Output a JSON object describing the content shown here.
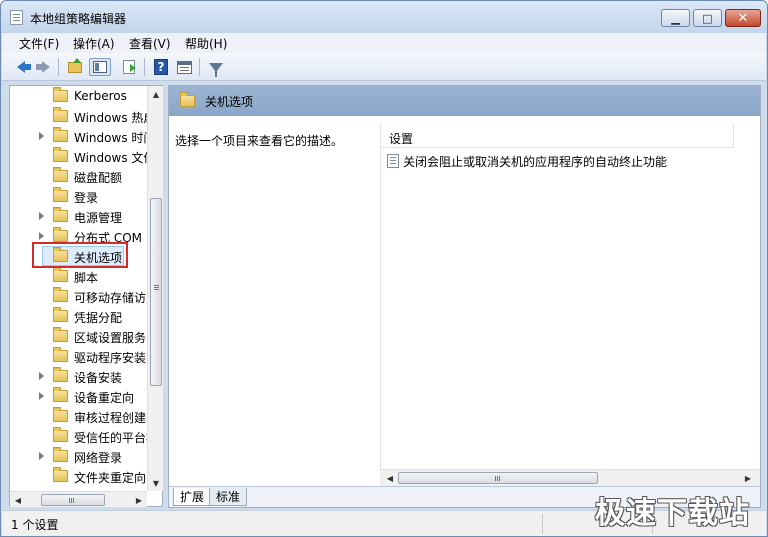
{
  "window": {
    "title": "本地组策略编辑器"
  },
  "menu": [
    {
      "label": "文件(F)"
    },
    {
      "label": "操作(A)"
    },
    {
      "label": "查看(V)"
    },
    {
      "label": "帮助(H)"
    }
  ],
  "tree": {
    "items": [
      {
        "label": "Kerberos",
        "expandable": false
      },
      {
        "label": "Windows 热启动",
        "expandable": false
      },
      {
        "label": "Windows 时间服务",
        "expandable": true
      },
      {
        "label": "Windows 文件保护",
        "expandable": false
      },
      {
        "label": "磁盘配额",
        "expandable": false
      },
      {
        "label": "登录",
        "expandable": false
      },
      {
        "label": "电源管理",
        "expandable": true
      },
      {
        "label": "分布式 COM",
        "expandable": true
      },
      {
        "label": "关机选项",
        "expandable": false,
        "selected": true
      },
      {
        "label": "脚本",
        "expandable": false
      },
      {
        "label": "可移动存储访问",
        "expandable": false
      },
      {
        "label": "凭据分配",
        "expandable": false
      },
      {
        "label": "区域设置服务",
        "expandable": false
      },
      {
        "label": "驱动程序安装",
        "expandable": false
      },
      {
        "label": "设备安装",
        "expandable": true
      },
      {
        "label": "设备重定向",
        "expandable": true
      },
      {
        "label": "审核过程创建",
        "expandable": false
      },
      {
        "label": "受信任的平台模块服务",
        "expandable": false
      },
      {
        "label": "网络登录",
        "expandable": true
      },
      {
        "label": "文件夹重定向",
        "expandable": false
      }
    ]
  },
  "details": {
    "header_title": "关机选项",
    "description": "选择一个项目来查看它的描述。",
    "column_header": "设置",
    "settings": [
      {
        "label": "关闭会阻止或取消关机的应用程序的自动终止功能"
      }
    ]
  },
  "tabs": [
    {
      "label": "扩展",
      "active": true
    },
    {
      "label": "标准",
      "active": false
    }
  ],
  "status": {
    "text": "1 个设置"
  },
  "watermark": "极速下载站"
}
